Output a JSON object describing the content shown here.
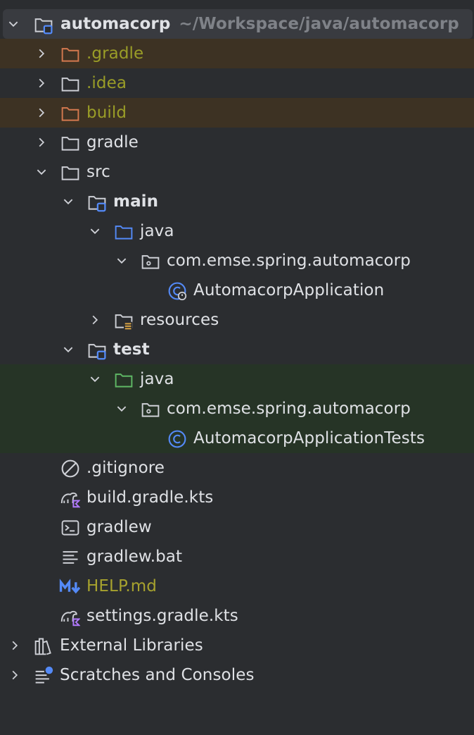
{
  "project": {
    "name": "automacorp",
    "path": "~/Workspace/java/automacorp"
  },
  "items": {
    "gradle_dot": ".gradle",
    "idea": ".idea",
    "build": "build",
    "gradle": "gradle",
    "src": "src",
    "main": "main",
    "main_java": "java",
    "main_package": "com.emse.spring.automacorp",
    "main_class": "AutomacorpApplication",
    "resources": "resources",
    "test": "test",
    "test_java": "java",
    "test_package": "com.emse.spring.automacorp",
    "test_class": "AutomacorpApplicationTests",
    "gitignore": ".gitignore",
    "build_gradle": "build.gradle.kts",
    "gradlew": "gradlew",
    "gradlew_bat": "gradlew.bat",
    "help": "HELP.md",
    "settings": "settings.gradle.kts",
    "external_libraries": "External Libraries",
    "scratches": "Scratches and Consoles"
  },
  "colors": {
    "background": "#2b2d30",
    "selected_row": "#393b40",
    "excluded_row": "#3d3223",
    "test_row": "#263426",
    "excluded_folder": "#d4794f",
    "source_folder": "#548af7",
    "test_folder": "#5fb865",
    "class_icon": "#548af7",
    "modified_text": "#9a9d27"
  },
  "icons": {
    "module": "module-folder-icon",
    "folder": "folder-icon",
    "package": "package-icon",
    "class": "class-icon",
    "gitignore": "ignored-file-icon",
    "gradle_kts": "gradle-kotlin-icon",
    "script": "terminal-icon",
    "text": "text-file-icon",
    "markdown": "markdown-icon",
    "libraries": "libraries-icon",
    "scratches": "scratches-icon"
  }
}
